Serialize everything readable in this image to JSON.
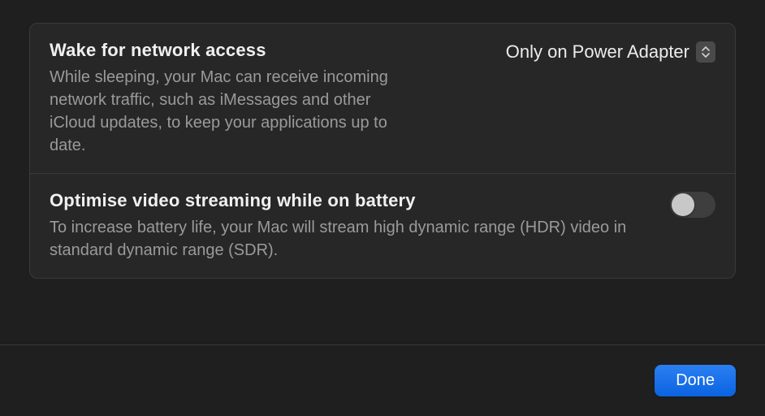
{
  "settings": [
    {
      "title": "Wake for network access",
      "description": "While sleeping, your Mac can receive incoming network traffic, such as iMessages and other iCloud updates, to keep your applications up to date.",
      "control_type": "dropdown",
      "value": "Only on Power Adapter"
    },
    {
      "title": "Optimise video streaming while on battery",
      "description": "To increase battery life, your Mac will stream high dynamic range (HDR) video in standard dynamic range (SDR).",
      "control_type": "toggle",
      "value": false
    }
  ],
  "footer": {
    "done_label": "Done"
  }
}
